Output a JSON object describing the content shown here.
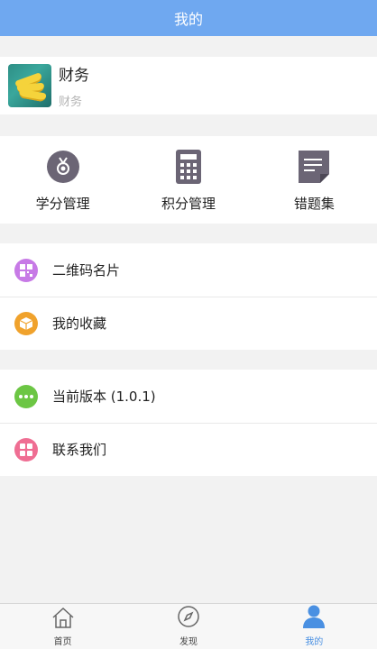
{
  "header": {
    "title": "我的"
  },
  "profile": {
    "name": "财务",
    "subtitle": "财务"
  },
  "grid": {
    "items": [
      {
        "label": "学分管理",
        "icon": "medal-icon"
      },
      {
        "label": "积分管理",
        "icon": "calculator-icon"
      },
      {
        "label": "错题集",
        "icon": "document-icon"
      }
    ]
  },
  "menu": {
    "group1": [
      {
        "label": "二维码名片",
        "icon": "qr-code-icon",
        "color": "#c77ae6"
      },
      {
        "label": "我的收藏",
        "icon": "box-icon",
        "color": "#f0a22c"
      }
    ],
    "group2": [
      {
        "label": "当前版本 (1.0.1)",
        "icon": "more-dots-icon",
        "color": "#6cc644"
      },
      {
        "label": "联系我们",
        "icon": "grid-icon",
        "color": "#ef6e93"
      }
    ]
  },
  "tabbar": {
    "items": [
      {
        "label": "首页",
        "icon": "home-icon"
      },
      {
        "label": "发现",
        "icon": "compass-icon"
      },
      {
        "label": "我的",
        "icon": "person-icon",
        "active": true
      }
    ],
    "active_color": "#4a90e2"
  },
  "colors": {
    "header": "#6fa8f0",
    "background": "#f2f2f2"
  }
}
